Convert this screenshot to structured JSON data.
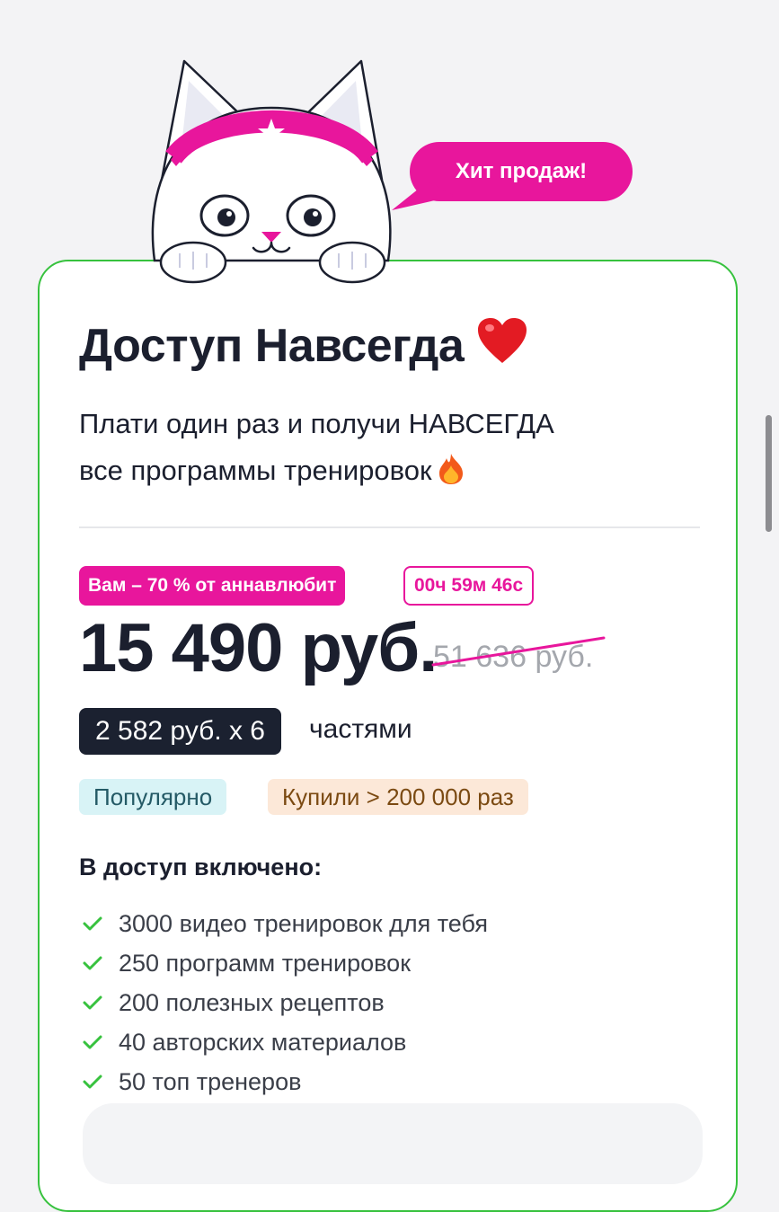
{
  "promo": {
    "bubble_text": "Хит продаж!"
  },
  "plan": {
    "title": "Доступ Навсегда",
    "subtitle_line1": "Плати один раз и получи НАВСЕГДА",
    "subtitle_line2": "все программы тренировок",
    "discount_badge": "Вам – 70 % от аннавлюбит",
    "timer": "00ч 59м 46с",
    "price": "15 490 руб.",
    "old_price": "51 636 руб.",
    "installment": "2 582 руб. x 6",
    "installment_suffix": "частями",
    "tags": [
      "Популярно",
      "Купили > 200 000 раз"
    ],
    "included_title": "В доступ включено:",
    "features": [
      "3000 видео тренировок для тебя",
      "250 программ тренировок",
      "200 полезных рецептов",
      "40 авторских материалов",
      "50 топ тренеров"
    ]
  },
  "icons": {
    "mascot": "cat-mascot-with-headband",
    "heart": "red-heart-emoji",
    "fire": "fire-emoji",
    "check": "check-icon"
  },
  "colors": {
    "accent_pink": "#e8169c",
    "card_border": "#37c23e",
    "dark": "#1b2130",
    "check_green": "#37c23e",
    "tag_popular_bg": "#d8f3f6",
    "tag_bought_bg": "#fce8d8"
  }
}
